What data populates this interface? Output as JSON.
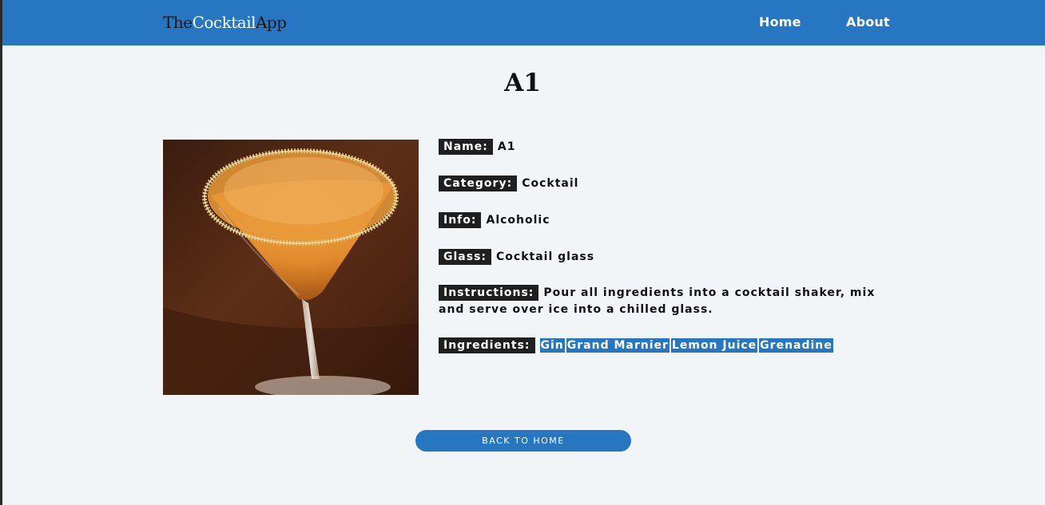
{
  "header": {
    "logo": {
      "part1": "The",
      "part2": "Cocktail",
      "part3": "App"
    },
    "nav": {
      "home": "Home",
      "about": "About"
    }
  },
  "page": {
    "title": "A1"
  },
  "cocktail": {
    "name_label": "Name:",
    "name": "A1",
    "category_label": "Category:",
    "category": "Cocktail",
    "info_label": "Info:",
    "info": "Alcoholic",
    "glass_label": "Glass:",
    "glass": "Cocktail glass",
    "instructions_label": "Instructions:",
    "instructions": "Pour all ingredients into a cocktail shaker, mix and serve over ice into a chilled glass.",
    "ingredients_label": "Ingredients:",
    "ingredients": [
      "Gin",
      "Grand Marnier",
      "Lemon Juice",
      "Grenadine"
    ]
  },
  "actions": {
    "back_label": "back to home"
  },
  "colors": {
    "primary": "#2776c2",
    "label_bg": "#1f1f1f",
    "page_bg": "#f1f5f8"
  }
}
